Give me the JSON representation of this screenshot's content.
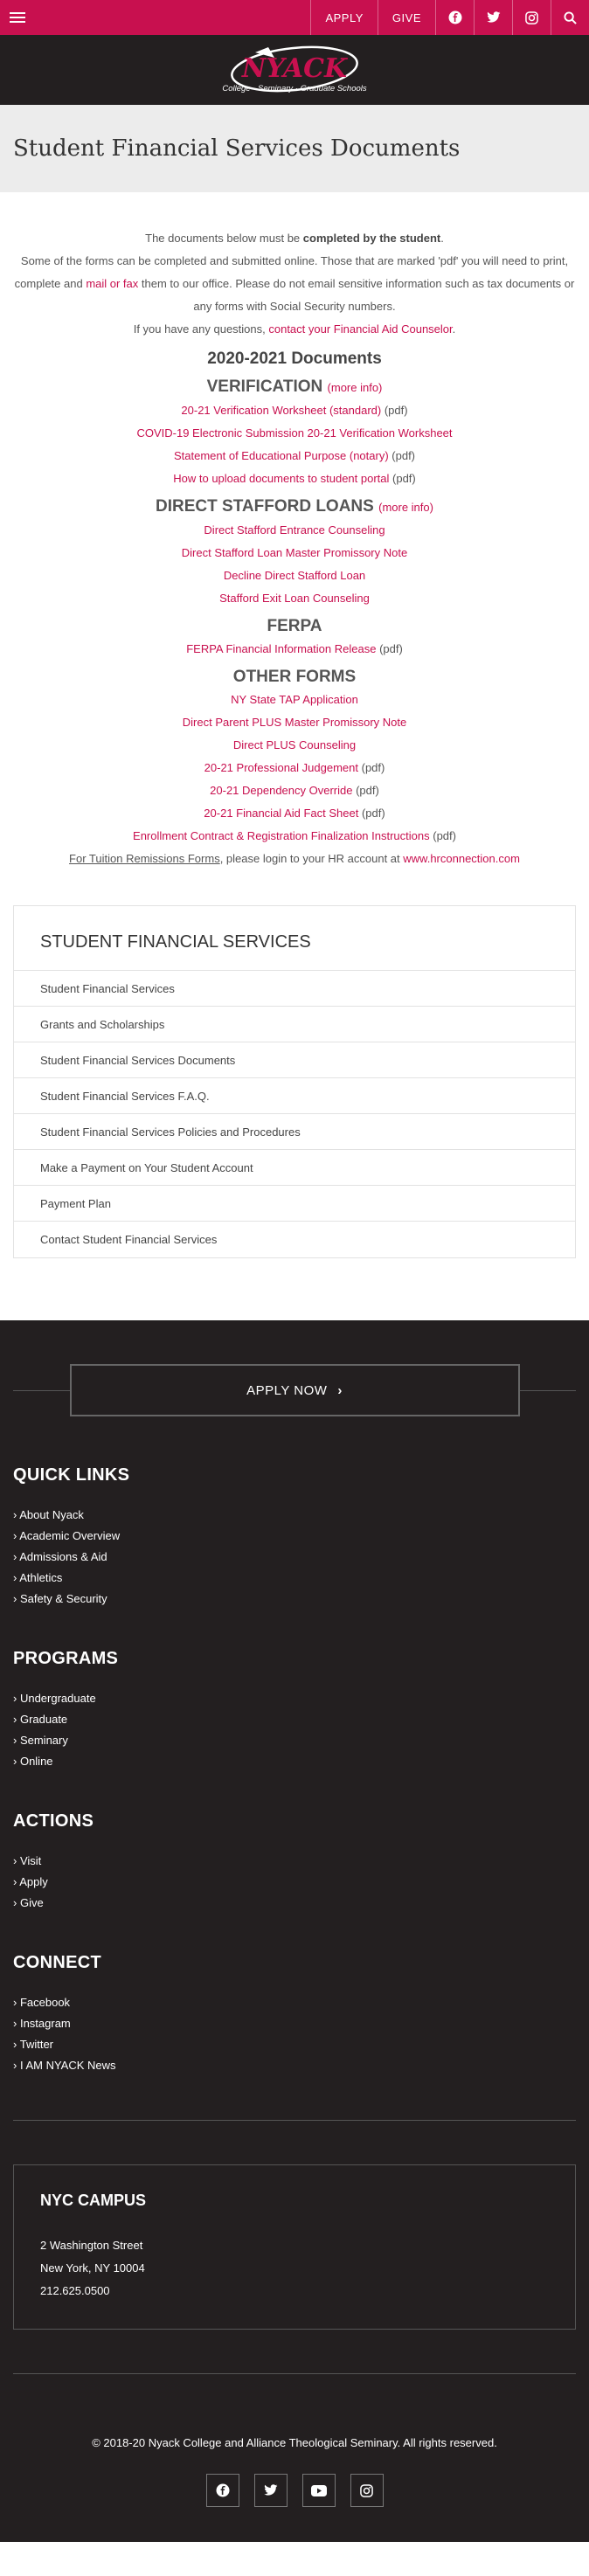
{
  "topbar": {
    "apply_label": "APPLY",
    "give_label": "GIVE",
    "icons": [
      "menu-icon",
      "facebook-icon",
      "twitter-icon",
      "instagram-icon",
      "search-icon"
    ]
  },
  "logo": {
    "name": "NYACK",
    "tagline": "College · Seminary · Graduate Schools"
  },
  "hero": {
    "title": "Student Financial Services Documents"
  },
  "intro": {
    "line1_pre": "The documents below must be ",
    "line1_bold": "completed by the student",
    "line1_post": ".",
    "line2_pre": "Some of the forms can be completed and submitted online. Those that are marked 'pdf' you will need to print, complete and ",
    "line2_link": "mail or fax",
    "line2_post": " them to our office. Please do not email sensitive information such as tax documents or any forms with Social Security numbers.",
    "line3_pre": "If you have any questions, ",
    "line3_link": "contact your Financial Aid Counselor",
    "line3_post": "."
  },
  "docs": {
    "year_title": "2020-2021 Documents",
    "verification": {
      "title": "VERIFICATION",
      "more": "(more info)",
      "rows": [
        {
          "link": "20-21 Verification Worksheet (standard)",
          "suffix": " (pdf)"
        },
        {
          "link": "COVID-19 Electronic Submission 20-21 Verification Worksheet",
          "suffix": ""
        },
        {
          "link": "Statement of Educational Purpose (notary)",
          "suffix": " (pdf)"
        },
        {
          "link": "How to upload documents to student portal",
          "suffix": " (pdf)"
        }
      ]
    },
    "stafford": {
      "title": "DIRECT STAFFORD LOANS",
      "more": "(more info)",
      "rows": [
        {
          "link": "Direct Stafford Entrance Counseling",
          "suffix": ""
        },
        {
          "link": "Direct Stafford Loan Master Promissory Note",
          "suffix": ""
        },
        {
          "link": "Decline Direct Stafford Loan",
          "suffix": ""
        },
        {
          "link": "Stafford Exit Loan Counseling",
          "suffix": ""
        }
      ]
    },
    "ferpa": {
      "title": "FERPA",
      "rows": [
        {
          "link": "FERPA Financial Information Release",
          "suffix": " (pdf)"
        }
      ]
    },
    "other": {
      "title": "OTHER FORMS",
      "rows": [
        {
          "link": "NY State TAP Application",
          "suffix": ""
        },
        {
          "link": "Direct Parent PLUS Master Promissory Note",
          "suffix": ""
        },
        {
          "link": "Direct PLUS Counseling",
          "suffix": ""
        },
        {
          "link": "20-21 Professional Judgement",
          "suffix": " (pdf)"
        },
        {
          "link": "20-21 Dependency Override",
          "suffix": " (pdf)"
        },
        {
          "link": "20-21 Financial Aid Fact Sheet",
          "suffix": " (pdf)"
        },
        {
          "link": "Enrollment Contract & Registration Finalization Instructions",
          "suffix": " (pdf)"
        }
      ]
    },
    "remission": {
      "link1": "For Tuition Remissions Forms",
      "middle": ", please login to your HR account at ",
      "link2": "www.hrconnection.com"
    }
  },
  "sidebar": {
    "title": "STUDENT FINANCIAL SERVICES",
    "items": [
      "Student Financial Services",
      "Grants and Scholarships",
      "Student Financial Services Documents",
      "Student Financial Services F.A.Q.",
      "Student Financial Services Policies and Procedures",
      "Make a Payment on Your Student Account",
      "Payment Plan",
      "Contact Student Financial Services"
    ]
  },
  "footer": {
    "apply_now": "APPLY NOW",
    "quick_links": {
      "title": "QUICK LINKS",
      "items": [
        "About Nyack",
        "Academic Overview",
        "Admissions & Aid",
        "Athletics",
        "Safety & Security"
      ]
    },
    "programs": {
      "title": "PROGRAMS",
      "items": [
        "Undergraduate",
        "Graduate",
        "Seminary",
        "Online"
      ]
    },
    "actions": {
      "title": "ACTIONS",
      "items": [
        "Visit",
        "Apply",
        "Give"
      ]
    },
    "connect": {
      "title": "CONNECT",
      "items": [
        "Facebook",
        "Instagram",
        "Twitter",
        "I AM NYACK News"
      ]
    },
    "campus": {
      "title": "NYC CAMPUS",
      "address1": "2 Washington Street",
      "address2": "New York, NY 10004",
      "phone": "212.625.0500"
    },
    "copyright": "© 2018-20 Nyack College and Alliance Theological Seminary. All rights reserved.",
    "social_icons": [
      "facebook-icon",
      "twitter-icon",
      "youtube-icon",
      "instagram-icon"
    ]
  },
  "colors": {
    "accent": "#c8104f",
    "dark": "#231f20",
    "hero_bg": "#ececec"
  }
}
